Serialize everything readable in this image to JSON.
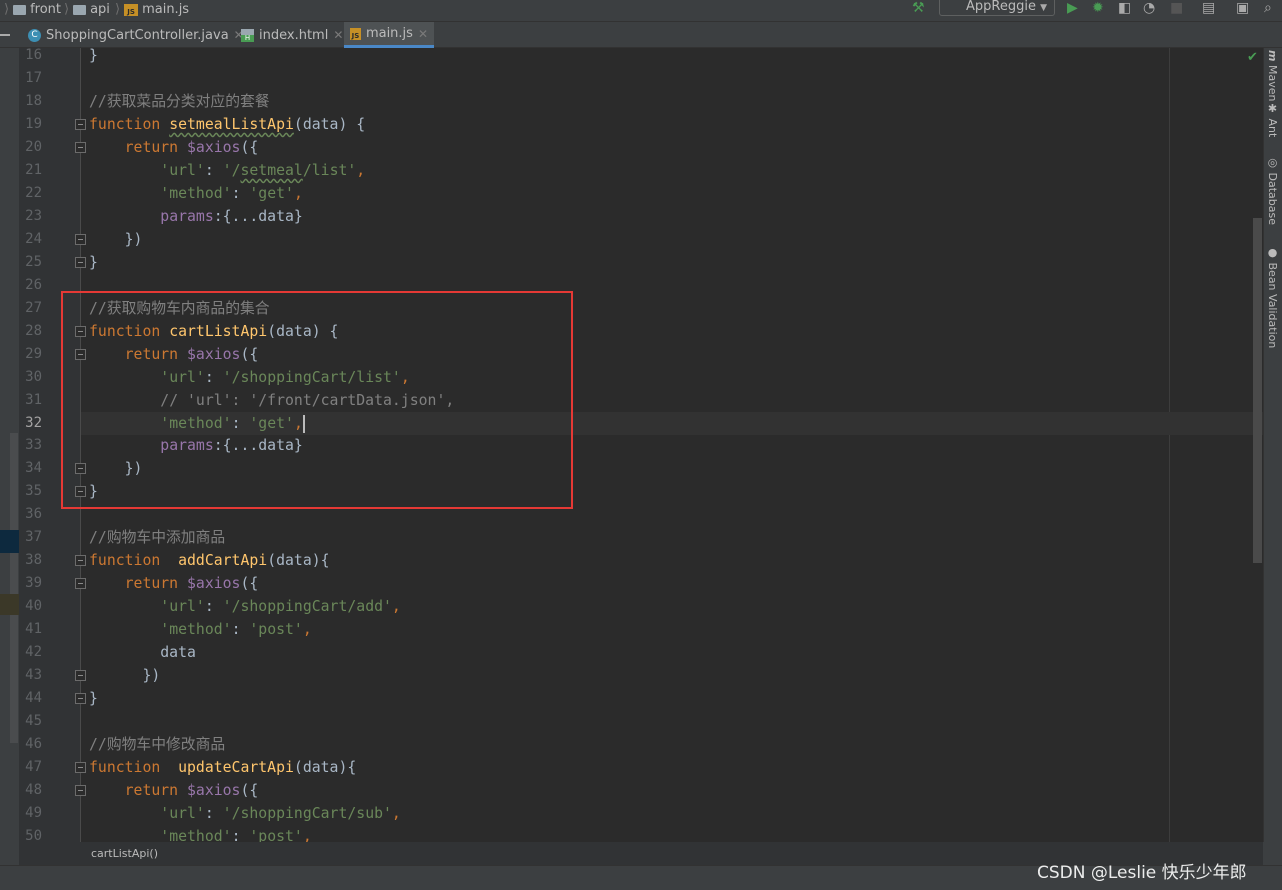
{
  "nav": {
    "items": [
      {
        "label": "front",
        "icon": "folder-icon"
      },
      {
        "label": "api",
        "icon": "folder-icon"
      },
      {
        "label": "main.js",
        "icon": "js-file-icon"
      }
    ]
  },
  "toolbar": {
    "run_config": "AppReggie"
  },
  "tabs": [
    {
      "label": "ShoppingCartController.java",
      "icon": "java-class-icon",
      "active": false
    },
    {
      "label": "index.html",
      "icon": "html-file-icon",
      "active": false
    },
    {
      "label": "main.js",
      "icon": "js-file-icon",
      "active": true
    }
  ],
  "editor": {
    "first_line": 16,
    "current_line": 32,
    "lines": [
      [
        [
          "pl",
          "}"
        ]
      ],
      [],
      [
        [
          "cm",
          "//获取菜品分类对应的套餐"
        ]
      ],
      [
        [
          "kw",
          "function "
        ],
        [
          "fn wavy",
          "setmealListApi"
        ],
        [
          "pl",
          "(data) {"
        ]
      ],
      [
        [
          "pl",
          "    "
        ],
        [
          "kw",
          "return "
        ],
        [
          "prop",
          "$axios"
        ],
        [
          "pl",
          "({"
        ]
      ],
      [
        [
          "pl",
          "        "
        ],
        [
          "str",
          "'url'"
        ],
        [
          "pl",
          ": "
        ],
        [
          "str",
          "'/"
        ],
        [
          "str wavy",
          "setmeal"
        ],
        [
          "str",
          "/list'"
        ],
        [
          "kw",
          ","
        ]
      ],
      [
        [
          "pl",
          "        "
        ],
        [
          "str",
          "'method'"
        ],
        [
          "pl",
          ": "
        ],
        [
          "str",
          "'get'"
        ],
        [
          "kw",
          ","
        ]
      ],
      [
        [
          "pl",
          "        "
        ],
        [
          "prop",
          "params"
        ],
        [
          "pl",
          ":{...data}"
        ]
      ],
      [
        [
          "pl",
          "    })"
        ]
      ],
      [
        [
          "pl",
          "}"
        ]
      ],
      [],
      [
        [
          "cm",
          "//获取购物车内商品的集合"
        ]
      ],
      [
        [
          "kw",
          "function "
        ],
        [
          "fn",
          "cartListApi"
        ],
        [
          "pl",
          "(data) {"
        ]
      ],
      [
        [
          "pl",
          "    "
        ],
        [
          "kw",
          "return "
        ],
        [
          "prop",
          "$axios"
        ],
        [
          "pl",
          "({"
        ]
      ],
      [
        [
          "pl",
          "        "
        ],
        [
          "str",
          "'url'"
        ],
        [
          "pl",
          ": "
        ],
        [
          "str",
          "'/shoppingCart/list'"
        ],
        [
          "kw",
          ","
        ]
      ],
      [
        [
          "pl",
          "        "
        ],
        [
          "cm",
          "// 'url': '/front/cartData.json',"
        ]
      ],
      [
        [
          "pl",
          "        "
        ],
        [
          "str",
          "'method'"
        ],
        [
          "pl",
          ": "
        ],
        [
          "str",
          "'get'"
        ],
        [
          "kw",
          ","
        ]
      ],
      [
        [
          "pl",
          "        "
        ],
        [
          "prop",
          "params"
        ],
        [
          "pl",
          ":{...data}"
        ]
      ],
      [
        [
          "pl",
          "    })"
        ]
      ],
      [
        [
          "pl",
          "}"
        ]
      ],
      [],
      [
        [
          "cm",
          "//购物车中添加商品"
        ]
      ],
      [
        [
          "kw",
          "function  "
        ],
        [
          "fn",
          "addCartApi"
        ],
        [
          "pl",
          "(data){"
        ]
      ],
      [
        [
          "pl",
          "    "
        ],
        [
          "kw",
          "return "
        ],
        [
          "prop",
          "$axios"
        ],
        [
          "pl",
          "({"
        ]
      ],
      [
        [
          "pl",
          "        "
        ],
        [
          "str",
          "'url'"
        ],
        [
          "pl",
          ": "
        ],
        [
          "str",
          "'/shoppingCart/add'"
        ],
        [
          "kw",
          ","
        ]
      ],
      [
        [
          "pl",
          "        "
        ],
        [
          "str",
          "'method'"
        ],
        [
          "pl",
          ": "
        ],
        [
          "str",
          "'post'"
        ],
        [
          "kw",
          ","
        ]
      ],
      [
        [
          "pl",
          "        data"
        ]
      ],
      [
        [
          "pl",
          "      })"
        ]
      ],
      [
        [
          "pl",
          "}"
        ]
      ],
      [],
      [
        [
          "cm",
          "//购物车中修改商品"
        ]
      ],
      [
        [
          "kw",
          "function  "
        ],
        [
          "fn",
          "updateCartApi"
        ],
        [
          "pl",
          "(data){"
        ]
      ],
      [
        [
          "pl",
          "    "
        ],
        [
          "kw",
          "return "
        ],
        [
          "prop",
          "$axios"
        ],
        [
          "pl",
          "({"
        ]
      ],
      [
        [
          "pl",
          "        "
        ],
        [
          "str",
          "'url'"
        ],
        [
          "pl",
          ": "
        ],
        [
          "str",
          "'/shoppingCart/sub'"
        ],
        [
          "kw",
          ","
        ]
      ],
      [
        [
          "pl",
          "        "
        ],
        [
          "str",
          "'method'"
        ],
        [
          "pl",
          ": "
        ],
        [
          "str",
          "'post'"
        ],
        [
          "kw",
          ","
        ]
      ]
    ]
  },
  "fold_lines": [
    19,
    20,
    24,
    25,
    28,
    29,
    34,
    35,
    38,
    39,
    43,
    44,
    47,
    48
  ],
  "right_tools": [
    {
      "label": "Maven",
      "icon": "maven-icon"
    },
    {
      "label": "Ant",
      "icon": "ant-icon"
    },
    {
      "label": "Database",
      "icon": "database-icon"
    },
    {
      "label": "Bean Validation",
      "icon": "bean-validation-icon"
    }
  ],
  "breadcrumb_footer": "cartListApi()",
  "watermark": "CSDN @Leslie 快乐少年郎",
  "colors": {
    "editor_bg": "#2b2b2b",
    "keyword": "#cc7832",
    "function": "#ffc66d",
    "string": "#6a8759",
    "comment": "#808080",
    "property": "#9876aa",
    "highlight_box": "#e53935"
  }
}
